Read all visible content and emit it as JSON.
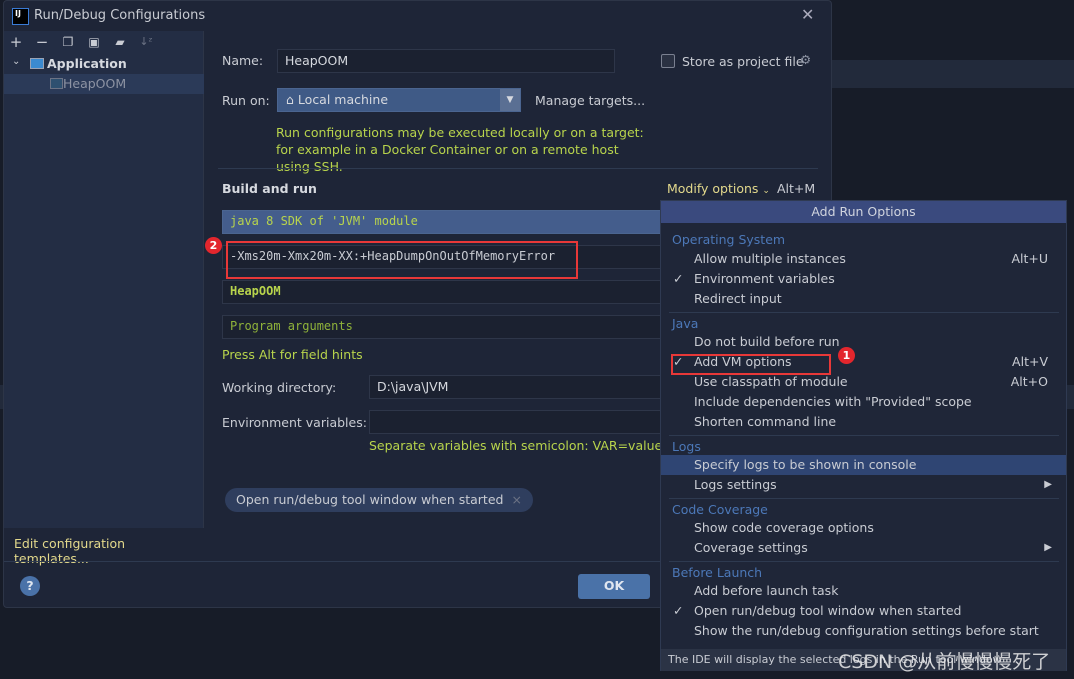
{
  "window": {
    "title": "Run/Debug Configurations",
    "logo": "IJ"
  },
  "toolbar": {
    "icons": [
      "plus-icon",
      "minus-icon",
      "copy-icon",
      "save-icon",
      "folder-add-icon",
      "sort-icon"
    ]
  },
  "tree": {
    "group": "Application",
    "item": "HeapOOM"
  },
  "sidebar": {
    "edit_templates": "Edit configuration templates..."
  },
  "form": {
    "name_label": "Name:",
    "name_value": "HeapOOM",
    "store_label": "Store as project file",
    "run_on_label": "Run on:",
    "run_on_value": "Local machine",
    "manage_targets": "Manage targets...",
    "hint": "Run configurations may be executed locally or on a target: for example in a Docker Container or on a remote host using SSH.",
    "build_run": "Build and run",
    "modify_options": "Modify options",
    "modify_shortcut": "Alt+M",
    "sdk": "java 8 SDK of 'JVM' module",
    "vm_options": "-Xms20m-Xmx20m-XX:+HeapDumpOnOutOfMemoryError",
    "main_class": "HeapOOM",
    "program_args_placeholder": "Program arguments",
    "field_hints": "Press Alt for field hints",
    "workdir_label": "Working directory:",
    "workdir_value": "D:\\java\\JVM",
    "env_label": "Environment variables:",
    "env_hint": "Separate variables with semicolon: VAR=value; VA",
    "chip": "Open run/debug tool window when started"
  },
  "buttons": {
    "ok": "OK",
    "help": "?"
  },
  "annotations": {
    "badge1": "1",
    "badge2": "2"
  },
  "popup": {
    "title": "Add Run Options",
    "sections": {
      "os": "Operating System",
      "java": "Java",
      "logs": "Logs",
      "coverage": "Code Coverage",
      "before": "Before Launch"
    },
    "items": {
      "allow_multiple": {
        "label": "Allow multiple instances",
        "shortcut": "Alt+U"
      },
      "env_vars": {
        "label": "Environment variables",
        "checked": true
      },
      "redirect": {
        "label": "Redirect input"
      },
      "no_build": {
        "label": "Do not build before run"
      },
      "vm_options": {
        "label": "Add VM options",
        "shortcut": "Alt+V",
        "checked": true
      },
      "classpath": {
        "label": "Use classpath of module",
        "shortcut": "Alt+O"
      },
      "provided": {
        "label": "Include dependencies with \"Provided\" scope"
      },
      "shorten": {
        "label": "Shorten command line"
      },
      "specify_logs": {
        "label": "Specify logs to be shown in console",
        "selected": true
      },
      "logs_settings": {
        "label": "Logs settings"
      },
      "show_coverage": {
        "label": "Show code coverage options"
      },
      "coverage_settings": {
        "label": "Coverage settings"
      },
      "add_before": {
        "label": "Add before launch task"
      },
      "open_tool": {
        "label": "Open run/debug tool window when started",
        "checked": true
      },
      "show_settings": {
        "label": "Show the run/debug configuration settings before start"
      }
    },
    "footer": "The IDE will display the selected logs in the Run tool window"
  },
  "watermark": "CSDN @从前慢慢慢死了",
  "colors": {
    "accent": "#4a72a8",
    "hint_green": "#b8d44c",
    "highlight": "#e83838"
  }
}
